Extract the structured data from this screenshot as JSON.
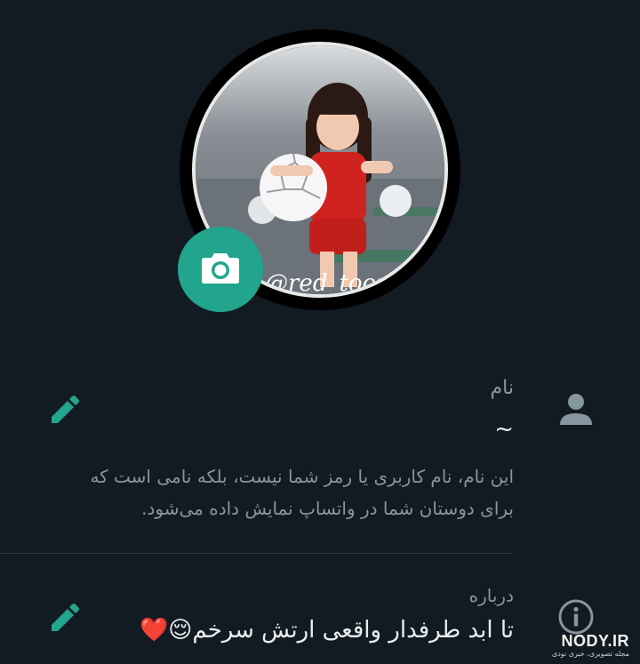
{
  "profile": {
    "photo_watermark": "@red_toory",
    "camera_icon": "camera-icon"
  },
  "name_row": {
    "label": "نام",
    "value": "~",
    "helper": "این نام، نام کاربری یا رمز شما نیست، بلکه نامی است که برای دوستان شما در واتساپ نمایش داده می‌شود.",
    "icon": "person-icon",
    "edit_icon": "pencil-icon"
  },
  "about_row": {
    "label": "درباره",
    "value": "تا ابد طرفدار واقعی ارتش سرخم😌❤️",
    "icon": "info-icon",
    "edit_icon": "pencil-icon"
  },
  "watermark": {
    "main": "NODY.IR",
    "sub": "مجله تصویری، خبری نودی"
  },
  "colors": {
    "background": "#121b22",
    "accent": "#21a68d",
    "secondary_text": "#8696a0",
    "primary_text": "#e9edef"
  }
}
